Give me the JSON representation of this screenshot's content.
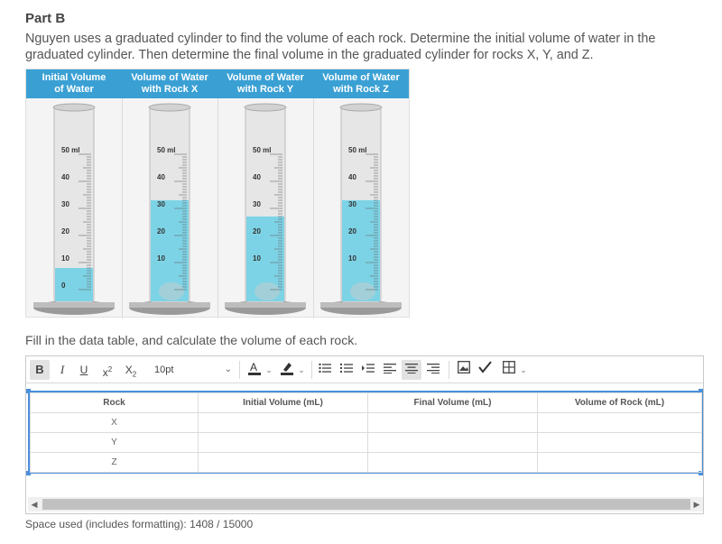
{
  "part_title": "Part B",
  "prompt": "Nguyen uses a graduated cylinder to find the volume of each rock. Determine the initial volume of water in the graduated cylinder. Then determine the final volume in the graduated cylinder for rocks X, Y, and Z.",
  "cylinders": {
    "headers": [
      [
        "Initial Volume",
        "of Water"
      ],
      [
        "Volume of Water",
        "with Rock X"
      ],
      [
        "Volume of Water",
        "with Rock Y"
      ],
      [
        "Volume of Water",
        "with Rock Z"
      ]
    ],
    "scale_labels": [
      "50 ml",
      "40",
      "30",
      "20",
      "10",
      "0"
    ],
    "water_levels_ml": [
      8,
      33,
      27,
      33
    ],
    "colors": {
      "header": "#3aa0d4",
      "water": "#7dd3e6",
      "glass": "#e6e6e6",
      "rock": "#a7cfd6"
    }
  },
  "fill_instruction": "Fill in the data table, and calculate the volume of each rock.",
  "toolbar": {
    "font_size": "10pt",
    "icons": [
      "bold-icon",
      "italic-icon",
      "underline-icon",
      "superscript-icon",
      "subscript-icon",
      "font-color-icon",
      "highlight-icon",
      "bulleted-list-icon",
      "numbered-list-icon",
      "indent-icon",
      "align-left-icon",
      "align-center-icon",
      "align-right-icon",
      "image-icon",
      "spellcheck-icon",
      "table-icon"
    ]
  },
  "table": {
    "headers": [
      "Rock",
      "Initial Volume (mL)",
      "Final Volume (mL)",
      "Volume of Rock (mL)"
    ],
    "rows": [
      [
        "X",
        "",
        "",
        ""
      ],
      [
        "Y",
        "",
        "",
        ""
      ],
      [
        "Z",
        "",
        "",
        ""
      ]
    ]
  },
  "space_used": "Space used (includes formatting): 1408 / 15000"
}
